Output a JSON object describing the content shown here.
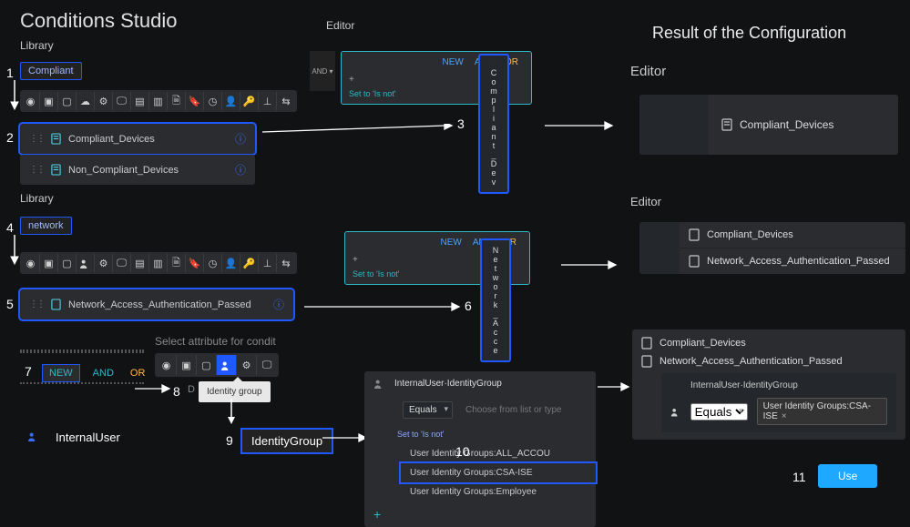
{
  "mainTitle": "Conditions Studio",
  "library1": {
    "label": "Library",
    "search": "Compliant",
    "items": [
      {
        "label": "Compliant_Devices"
      },
      {
        "label": "Non_Compliant_Devices"
      }
    ]
  },
  "library2": {
    "label": "Library",
    "search": "network",
    "items": [
      {
        "label": "Network_Access_Authentication_Passed"
      }
    ]
  },
  "editor": {
    "label": "Editor",
    "andLabel": "AND",
    "newLabel": "NEW",
    "orLabel": "OR",
    "setIsNot": "Set to 'Is not'"
  },
  "vertDrop1": "Compliant_Devices",
  "vertDrop2": "Network_Access",
  "step7": {
    "new": "NEW",
    "and": "AND",
    "or": "OR"
  },
  "selectAttr": "Select attribute for condit",
  "tooltip": "Identity group",
  "internalUser": "InternalUser",
  "internalUserLetter": "D",
  "identityGroup": "IdentityGroup",
  "idDropdown": {
    "header": "InternalUser·IdentityGroup",
    "op": "Equals",
    "choose": "Choose from list or type",
    "setIsNot": "Set to 'Is not'",
    "opts": [
      "User Identity Groups:ALL_ACCOU",
      "User Identity Groups:CSA-ISE",
      "User Identity Groups:Employee"
    ],
    "plus": "+"
  },
  "resultTitle": "Result of the Configuration",
  "resultEditor": "Editor",
  "resultCard1": "Compliant_Devices",
  "resultMini": {
    "row1": "Compliant_Devices",
    "row2": "Network_Access_Authentication_Passed"
  },
  "final": {
    "row1": "Compliant_Devices",
    "row2": "Network_Access_Authentication_Passed",
    "row3Header": "InternalUser·IdentityGroup",
    "row3Op": "Equals",
    "row3Val": "User Identity Groups:CSA-ISE"
  },
  "steps": [
    "1",
    "2",
    "3",
    "4",
    "5",
    "6",
    "7",
    "8",
    "9",
    "10",
    "11"
  ],
  "useBtn": "Use"
}
